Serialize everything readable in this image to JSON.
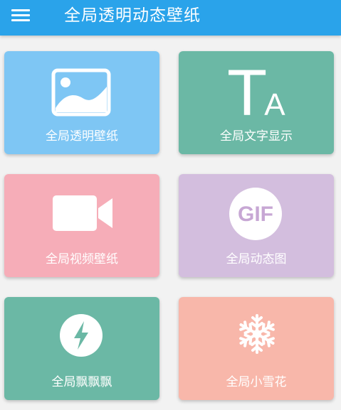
{
  "app": {
    "title": "全局透明动态壁纸",
    "menu_icon": "hamburger-menu-icon"
  },
  "colors": {
    "appbar": "#2aa3ea",
    "background": "#f2f2f2",
    "card_blue": "#7ec6f4",
    "card_green": "#6bb8a5",
    "card_pink": "#f6adb8",
    "card_purple": "#d3bede",
    "card_green2": "#6bb8a5",
    "card_salmon": "#f8b7aa"
  },
  "cards": [
    {
      "label": "全局透明壁纸",
      "icon": "image-icon"
    },
    {
      "label": "全局文字显示",
      "icon": "text-icon",
      "icon_text": "TA"
    },
    {
      "label": "全局视频壁纸",
      "icon": "video-camera-icon"
    },
    {
      "label": "全局动态图",
      "icon": "gif-icon",
      "icon_text": "GIF"
    },
    {
      "label": "全局飘飘飘",
      "icon": "lightning-icon"
    },
    {
      "label": "全局小雪花",
      "icon": "snowflake-icon"
    }
  ]
}
